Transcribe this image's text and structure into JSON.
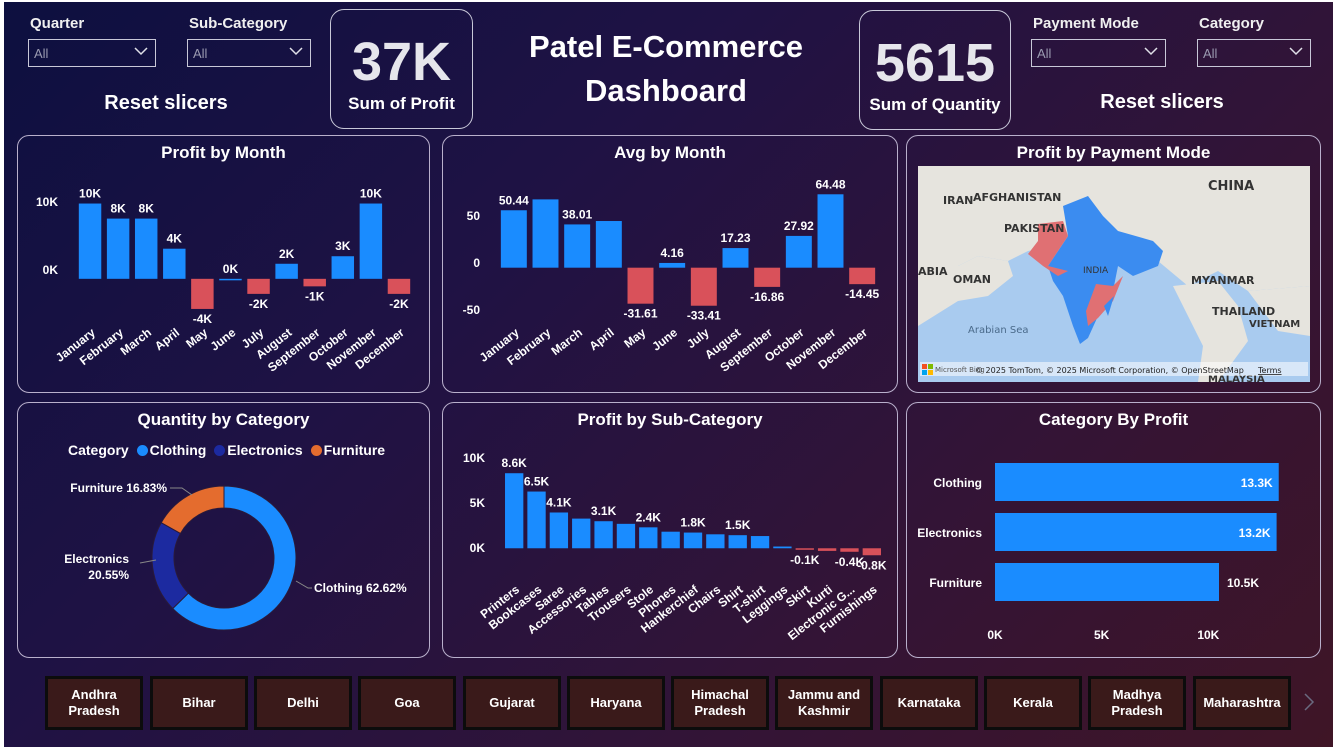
{
  "header": {
    "title_line1": "Patel E-Commerce",
    "title_line2": "Dashboard"
  },
  "slicers": {
    "quarter": {
      "label": "Quarter",
      "value": "All"
    },
    "sub_category": {
      "label": "Sub-Category",
      "value": "All"
    },
    "payment_mode": {
      "label": "Payment Mode",
      "value": "All"
    },
    "category": {
      "label": "Category",
      "value": "All"
    },
    "reset_left": "Reset slicers",
    "reset_right": "Reset slicers"
  },
  "cards": {
    "profit": {
      "value": "37K",
      "caption": "Sum of Profit"
    },
    "quantity": {
      "value": "5615",
      "caption": "Sum of Quantity"
    }
  },
  "colors": {
    "positive": "#1a8cff",
    "negative": "#d9515a",
    "clothing": "#1a8cff",
    "electronics": "#1c2aa0",
    "furniture": "#e46c2e"
  },
  "panels": {
    "profit_by_month": "Profit by Month",
    "avg_by_month": "Avg by Month",
    "profit_by_payment_mode": "Profit by Payment Mode",
    "quantity_by_category": "Quantity by Category",
    "profit_by_sub_category": "Profit by Sub-Category",
    "category_by_profit": "Category By Profit"
  },
  "map": {
    "labels": [
      "IRAN",
      "AFGHANISTAN",
      "PAKISTAN",
      "CHINA",
      "INDIA",
      "OMAN",
      "ABIA",
      "Arabian Sea",
      "MYANMAR",
      "THAILAND",
      "VIETNAM",
      "MALAYSIA"
    ],
    "attribution": "© 2025 TomTom, © 2025 Microsoft Corporation, © OpenStreetMap",
    "terms": "Terms",
    "brand": "Microsoft Bing"
  },
  "states": [
    "Andhra Pradesh",
    "Bihar",
    "Delhi",
    "Goa",
    "Gujarat",
    "Haryana",
    "Himachal Pradesh",
    "Jammu and Kashmir",
    "Karnataka",
    "Kerala",
    "Madhya Pradesh",
    "Maharashtra"
  ],
  "chart_data": [
    {
      "id": "profit_by_month",
      "type": "bar",
      "title": "Profit by Month",
      "categories": [
        "January",
        "February",
        "March",
        "April",
        "May",
        "June",
        "July",
        "August",
        "September",
        "October",
        "November",
        "December"
      ],
      "values": [
        10000,
        8000,
        8000,
        4000,
        -4000,
        0,
        -2000,
        2000,
        -1000,
        3000,
        10000,
        -2000
      ],
      "data_labels": [
        "10K",
        "8K",
        "8K",
        "4K",
        "-4K",
        "0K",
        "-2K",
        "2K",
        "-1K",
        "3K",
        "10K",
        "-2K"
      ],
      "yticks": [
        "10K",
        "0K"
      ],
      "ylim": [
        -6000,
        11000
      ]
    },
    {
      "id": "avg_by_month",
      "type": "bar",
      "title": "Avg by Month",
      "categories": [
        "January",
        "February",
        "March",
        "April",
        "May",
        "June",
        "July",
        "August",
        "September",
        "October",
        "November",
        "December"
      ],
      "values": [
        50.44,
        60,
        38.01,
        41,
        -31.61,
        4.16,
        -33.41,
        17.23,
        -16.86,
        27.92,
        64.48,
        -14.45
      ],
      "data_labels": [
        "50.44",
        "",
        "38.01",
        "",
        "-31.61",
        "4.16",
        "-33.41",
        "17.23",
        "-16.86",
        "27.92",
        "64.48",
        "-14.45"
      ],
      "yticks": [
        "50",
        "0",
        "-50"
      ],
      "ylim": [
        -60,
        70
      ]
    },
    {
      "id": "quantity_by_category",
      "type": "pie",
      "title": "Quantity by Category",
      "legend_title": "Category",
      "categories": [
        "Clothing",
        "Electronics",
        "Furniture"
      ],
      "values": [
        62.62,
        20.55,
        16.83
      ],
      "data_labels": [
        "Clothing 62.62%",
        "Electronics 20.55%",
        "Furniture 16.83%"
      ]
    },
    {
      "id": "profit_by_sub_category",
      "type": "bar",
      "title": "Profit by Sub-Category",
      "categories": [
        "Printers",
        "Bookcases",
        "Saree",
        "Accessories",
        "Tables",
        "Trousers",
        "Stole",
        "Phones",
        "Hankerchief",
        "Chairs",
        "Shirt",
        "T-shirt",
        "Leggings",
        "Skirt",
        "Kurti",
        "Electronic G...",
        "Furnishings"
      ],
      "values": [
        8600,
        6500,
        4100,
        3400,
        3100,
        2800,
        2400,
        1900,
        1800,
        1600,
        1500,
        1400,
        200,
        -100,
        -300,
        -400,
        -800
      ],
      "data_labels": [
        "8.6K",
        "6.5K",
        "4.1K",
        "",
        "3.1K",
        "",
        "2.4K",
        "",
        "1.8K",
        "",
        "1.5K",
        "",
        "",
        "-0.1K",
        "",
        "-0.4K",
        "-0.8K"
      ],
      "yticks": [
        "10K",
        "5K",
        "0K"
      ],
      "ylim": [
        -1000,
        10000
      ]
    },
    {
      "id": "category_by_profit",
      "type": "bar",
      "orientation": "horizontal",
      "title": "Category By Profit",
      "categories": [
        "Clothing",
        "Electronics",
        "Furniture"
      ],
      "values": [
        13300,
        13200,
        10500
      ],
      "data_labels": [
        "13.3K",
        "13.2K",
        "10.5K"
      ],
      "xticks": [
        "0K",
        "5K",
        "10K"
      ],
      "xlim": [
        0,
        13500
      ]
    }
  ]
}
